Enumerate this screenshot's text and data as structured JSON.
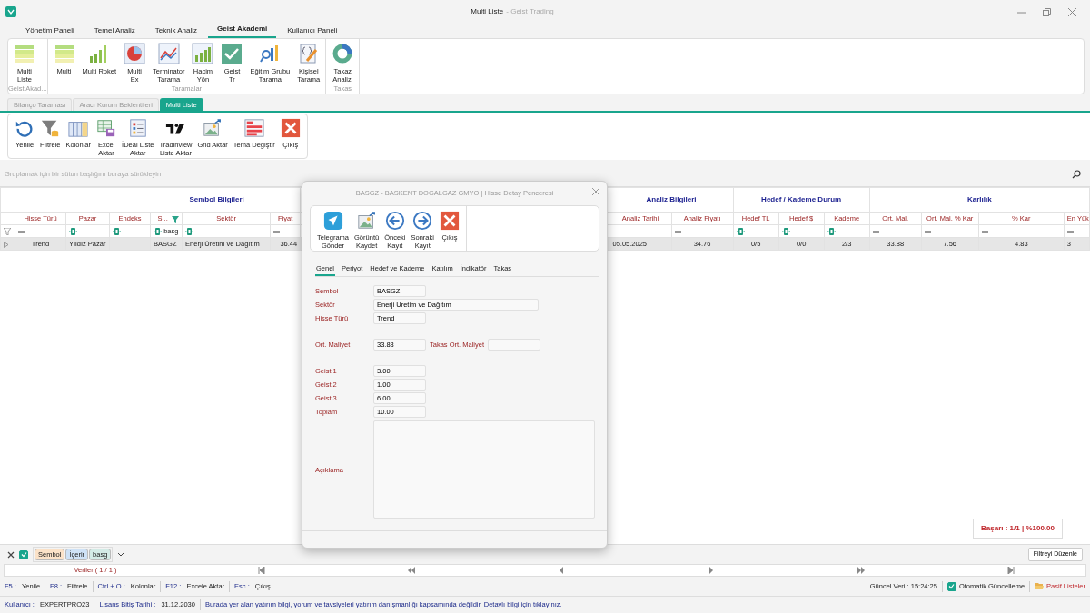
{
  "window": {
    "title": "Multi Liste",
    "subtitle": "- Geist Trading"
  },
  "ribbon_tabs": [
    {
      "label": "Yönetim Paneli",
      "selected": false
    },
    {
      "label": "Temel Analiz",
      "selected": false
    },
    {
      "label": "Teknik Analiz",
      "selected": false
    },
    {
      "label": "Geist Akademi",
      "selected": true
    },
    {
      "label": "Kullanıcı Paneli",
      "selected": false
    }
  ],
  "ribbon_groups": [
    {
      "label": "Geist Akad...",
      "items": [
        {
          "label": "Multi\nListe",
          "kind": "layers"
        }
      ]
    },
    {
      "label": "Taramalar",
      "items": [
        {
          "label": "Multi",
          "kind": "layers"
        },
        {
          "label": "Multi Roket",
          "kind": "signal"
        },
        {
          "label": "Multi\nEx",
          "kind": "pie"
        },
        {
          "label": "Terminator\nTarama",
          "kind": "line"
        },
        {
          "label": "Hacim\nYön",
          "kind": "bars"
        },
        {
          "label": "Geist\nTr",
          "kind": "check"
        },
        {
          "label": "Eğitim Grubu\nTarama",
          "kind": "search"
        },
        {
          "label": "Kişisel\nTarama",
          "kind": "code"
        }
      ]
    },
    {
      "label": "Takas",
      "items": [
        {
          "label": "Takaz\nAnalizi",
          "kind": "donut"
        }
      ]
    }
  ],
  "document_tabs": [
    {
      "label": "Bilanço Taraması",
      "selected": false
    },
    {
      "label": "Aracı Kurum Beklentileri",
      "selected": false
    },
    {
      "label": "Multi Liste",
      "selected": true
    }
  ],
  "toolbar": [
    {
      "label": "Yenile",
      "kind": "refresh"
    },
    {
      "label": "Filtrele",
      "kind": "funnel"
    },
    {
      "label": "Kolonlar",
      "kind": "columns"
    },
    {
      "label": "Excel\nAktar",
      "kind": "excel"
    },
    {
      "label": "İDeal Liste\nAktar",
      "kind": "list"
    },
    {
      "label": "Tradinview\nListe Aktar",
      "kind": "tv"
    },
    {
      "label": "Grid Aktar",
      "kind": "image"
    },
    {
      "label": "Tema Değiştir",
      "kind": "theme"
    },
    {
      "label": "Çıkış",
      "kind": "close"
    }
  ],
  "group_panel": {
    "hint": "Gruplamak için bir sütun başlığını buraya sürükleyin"
  },
  "grid": {
    "bands": [
      {
        "title": "Sembol Bilgileri",
        "columns": [
          {
            "header": "Hisse Türü",
            "filter": {
              "kind": "equals"
            },
            "filtered": false
          },
          {
            "header": "Pazar",
            "filter": {
              "kind": "contains"
            },
            "filtered": false
          },
          {
            "header": "Endeks",
            "filter": {
              "kind": "contains"
            },
            "filtered": false
          },
          {
            "header": "S...",
            "filter": {
              "kind": "contains",
              "value": "basg"
            },
            "filtered": true
          },
          {
            "header": "Sektör",
            "filter": {
              "kind": "contains"
            },
            "filtered": false
          },
          {
            "header": "Fiyat",
            "filter": {
              "kind": "equals"
            },
            "filtered": false
          }
        ]
      },
      {
        "title": "Analiz Bilgileri",
        "columns": [
          {
            "header": "Analiz Tarihi",
            "filtered": false
          },
          {
            "header": "Analiz Fiyatı",
            "filter": {
              "kind": "equals"
            },
            "filtered": false
          }
        ]
      },
      {
        "title": "Hedef / Kademe Durum",
        "columns": [
          {
            "header": "Hedef TL",
            "filter": {
              "kind": "contains"
            },
            "filtered": false
          },
          {
            "header": "Hedef $",
            "filter": {
              "kind": "contains"
            },
            "filtered": false
          },
          {
            "header": "Kademe",
            "filter": {
              "kind": "contains"
            },
            "filtered": false
          }
        ]
      },
      {
        "title": "Karlılık",
        "columns": [
          {
            "header": "Ort. Mal.",
            "filter": {
              "kind": "equals"
            },
            "filtered": false
          },
          {
            "header": "Ort. Mal. % Kar",
            "filter": {
              "kind": "equals"
            },
            "filtered": false
          },
          {
            "header": "% Kar",
            "filter": {
              "kind": "equals"
            },
            "filtered": false
          },
          {
            "header": "En Yük",
            "filter": {
              "kind": "equals"
            },
            "filtered": false
          }
        ]
      }
    ],
    "rows": [
      {
        "selected": true,
        "cells": [
          "Trend",
          "Yıldız Pazar",
          "",
          "BASGZ",
          "Enerji Üretim ve Dağıtım",
          "36.44",
          "05.05.2025",
          "34.76",
          "0/5",
          "0/0",
          "2/3",
          "33.88",
          "7.56",
          "4.83",
          "3"
        ]
      }
    ],
    "summary": "Başarı : 1/1 | %100.00"
  },
  "filter_bar": {
    "enabled": true,
    "chips": [
      {
        "text": "Sembol",
        "color": "#fbe2c8"
      },
      {
        "text": "İçerir",
        "color": "#cfe2f6"
      },
      {
        "text": "basg",
        "color": "#d3ebe6"
      }
    ],
    "edit_button": "Filtreyi Düzenle"
  },
  "navigator": {
    "label": "Veriler ( 1 / 1 )"
  },
  "shortcuts": [
    {
      "key": "F5 :",
      "action": "Yenile"
    },
    {
      "key": "F8 :",
      "action": "Filtrele"
    },
    {
      "key": "Ctrl + O :",
      "action": "Kolonlar"
    },
    {
      "key": "F12 :",
      "action": "Excele Aktar"
    },
    {
      "key": "Esc :",
      "action": "Çıkış"
    }
  ],
  "update_info": {
    "label": "Güncel Veri : 15:24:25",
    "auto_update": {
      "label": "Otomatik Güncelleme",
      "checked": true
    },
    "passive_lists": "Pasif Listeler"
  },
  "status_bar": {
    "fields": [
      {
        "label": "Kullanıcı :",
        "value": "EXPERTPRO23"
      },
      {
        "label": "Lisans Bitiş Tarihi :",
        "value": "31.12.2030"
      }
    ],
    "notice": "Burada yer alan yatırım bilgi, yorum ve tavsiyeleri yatırım danışmanlığı kapsamında değildir. Detaylı bilgi için tıklayınız."
  },
  "dialog": {
    "title": "BASGZ - BASKENT DOGALGAZ GMYO | Hisse Detay Penceresi",
    "toolbar": [
      {
        "label": "Telegrama\nGönder",
        "kind": "telegram"
      },
      {
        "label": "Görüntü\nKaydet",
        "kind": "image"
      },
      {
        "label": "Önceki\nKayıt",
        "kind": "left"
      },
      {
        "label": "Sonraki\nKayıt",
        "kind": "right"
      },
      {
        "label": "Çıkış",
        "kind": "close"
      }
    ],
    "tabs": [
      {
        "label": "Genel",
        "selected": true
      },
      {
        "label": "Periyot",
        "selected": false
      },
      {
        "label": "Hedef ve Kademe",
        "selected": false
      },
      {
        "label": "Katılım",
        "selected": false
      },
      {
        "label": "İndikatör",
        "selected": false
      },
      {
        "label": "Takas",
        "selected": false
      }
    ],
    "sections": [
      {
        "rows": [
          {
            "fields": [
              {
                "label": "Sembol",
                "value": "BASGZ",
                "kind": "short"
              }
            ]
          },
          {
            "fields": [
              {
                "label": "Sektör",
                "value": "Enerji Üretim ve Dağıtım",
                "kind": "wide"
              }
            ]
          },
          {
            "fields": [
              {
                "label": "Hisse Türü",
                "value": "Trend",
                "kind": "short"
              }
            ]
          }
        ]
      },
      {
        "rows": [
          {
            "fields": [
              {
                "label": "Ort. Maliyet",
                "value": "33.88",
                "kind": "short"
              },
              {
                "label": "Takas Ort. Maliyet",
                "kind": "short"
              }
            ]
          }
        ]
      },
      {
        "rows": [
          {
            "fields": [
              {
                "label": "Geist 1",
                "value": "3.00",
                "kind": "short"
              }
            ]
          },
          {
            "fields": [
              {
                "label": "Geist 2",
                "value": "1.00",
                "kind": "short"
              }
            ]
          },
          {
            "fields": [
              {
                "label": "Geist 3",
                "value": "6.00",
                "kind": "short"
              }
            ]
          },
          {
            "fields": [
              {
                "label": "Toplam",
                "value": "10.00",
                "kind": "short"
              }
            ]
          },
          {
            "fields": [
              {
                "label": "Açıklama",
                "kind": "textarea"
              }
            ]
          }
        ]
      }
    ]
  }
}
